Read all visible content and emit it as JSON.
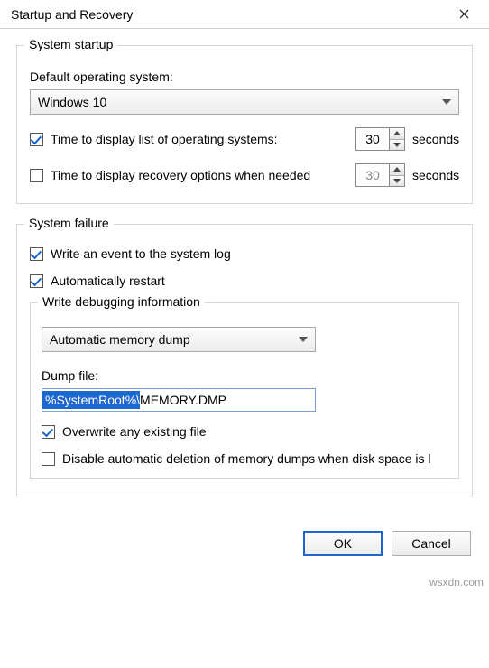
{
  "window": {
    "title": "Startup and Recovery"
  },
  "startup": {
    "group_title": "System startup",
    "default_os_label": "Default operating system:",
    "default_os_value": "Windows 10",
    "display_list_label": "Time to display list of operating systems:",
    "display_list_checked": true,
    "display_list_value": "30",
    "display_recovery_label": "Time to display recovery options when needed",
    "display_recovery_checked": false,
    "display_recovery_value": "30",
    "seconds_label": "seconds"
  },
  "failure": {
    "group_title": "System failure",
    "write_event_label": "Write an event to the system log",
    "write_event_checked": true,
    "auto_restart_label": "Automatically restart",
    "auto_restart_checked": true,
    "debug_group_title": "Write debugging information",
    "debug_select_value": "Automatic memory dump",
    "dump_file_label": "Dump file:",
    "dump_file_selected": "%SystemRoot%\\",
    "dump_file_rest": "MEMORY.DMP",
    "overwrite_label": "Overwrite any existing file",
    "overwrite_checked": true,
    "disable_delete_label": "Disable automatic deletion of memory dumps when disk space is l",
    "disable_delete_checked": false
  },
  "buttons": {
    "ok": "OK",
    "cancel": "Cancel"
  },
  "watermark": "wsxdn.com"
}
